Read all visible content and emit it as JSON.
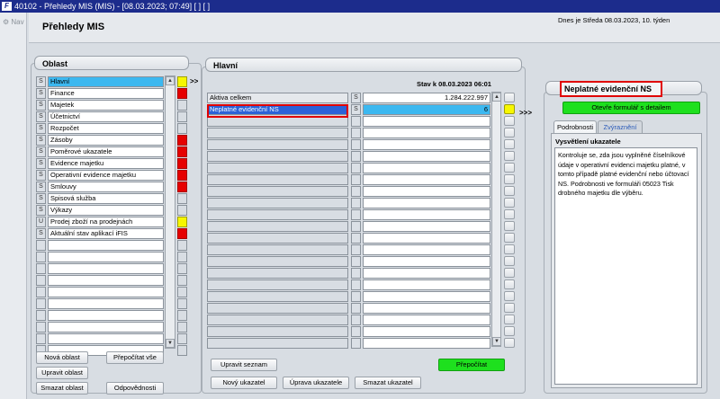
{
  "window": {
    "title": "40102 - Přehledy MIS (MIS) - [08.03.2023; 07:49] [ ] [ ]"
  },
  "nav": {
    "label": "Nav"
  },
  "header": {
    "title": "Přehledy MIS",
    "today": "Dnes je Středa   08.03.2023, 10. týden"
  },
  "oblast": {
    "title": "Oblast",
    "rows": [
      {
        "flag": "S",
        "label": "Hlavní",
        "status": "yellow",
        "selected": true
      },
      {
        "flag": "S",
        "label": "Finance",
        "status": "red"
      },
      {
        "flag": "S",
        "label": "Majetek",
        "status": "empty"
      },
      {
        "flag": "S",
        "label": "Účetnictví",
        "status": "empty"
      },
      {
        "flag": "S",
        "label": "Rozpočet",
        "status": "empty"
      },
      {
        "flag": "S",
        "label": "Zásoby",
        "status": "red"
      },
      {
        "flag": "S",
        "label": "Poměrové ukazatele",
        "status": "red"
      },
      {
        "flag": "S",
        "label": "Evidence majetku",
        "status": "red"
      },
      {
        "flag": "S",
        "label": "Operativní evidence majetku",
        "status": "red"
      },
      {
        "flag": "S",
        "label": "Smlouvy",
        "status": "red"
      },
      {
        "flag": "S",
        "label": "Spisová služba",
        "status": "empty"
      },
      {
        "flag": "S",
        "label": "Výkazy",
        "status": "empty"
      },
      {
        "flag": "U",
        "label": "Prodej zboží na prodejnách",
        "status": "yellow"
      },
      {
        "flag": "S",
        "label": "Aktuální stav aplikací iFIS",
        "status": "red"
      },
      {
        "flag": "",
        "label": "",
        "status": "empty"
      },
      {
        "flag": "",
        "label": "",
        "status": "empty"
      },
      {
        "flag": "",
        "label": "",
        "status": "empty"
      },
      {
        "flag": "",
        "label": "",
        "status": "empty"
      },
      {
        "flag": "",
        "label": "",
        "status": "empty"
      },
      {
        "flag": "",
        "label": "",
        "status": "empty"
      },
      {
        "flag": "",
        "label": "",
        "status": "empty"
      },
      {
        "flag": "",
        "label": "",
        "status": "empty"
      },
      {
        "flag": "",
        "label": "",
        "status": "empty"
      },
      {
        "flag": "",
        "label": "",
        "status": "empty"
      }
    ],
    "arrow": ">>",
    "buttons": {
      "new": "Nová oblast",
      "recalc_all": "Přepočítat vše",
      "edit": "Upravit oblast",
      "delete": "Smazat oblast",
      "responsibilities": "Odpovědnosti"
    }
  },
  "hlavni": {
    "title": "Hlavní",
    "state": "Stav k 08.03.2023 06:01",
    "rows": [
      {
        "name": "Aktiva celkem",
        "flag": "S",
        "value": "1.284.222.997",
        "indicator": ""
      },
      {
        "name": "Neplatné evidenční NS",
        "flag": "S",
        "value": "6",
        "indicator": "yellow",
        "selected": true
      },
      {
        "name": "",
        "flag": "",
        "value": "",
        "indicator": ""
      },
      {
        "name": "",
        "flag": "",
        "value": "",
        "indicator": ""
      },
      {
        "name": "",
        "flag": "",
        "value": "",
        "indicator": ""
      },
      {
        "name": "",
        "flag": "",
        "value": "",
        "indicator": ""
      },
      {
        "name": "",
        "flag": "",
        "value": "",
        "indicator": ""
      },
      {
        "name": "",
        "flag": "",
        "value": "",
        "indicator": ""
      },
      {
        "name": "",
        "flag": "",
        "value": "",
        "indicator": ""
      },
      {
        "name": "",
        "flag": "",
        "value": "",
        "indicator": ""
      },
      {
        "name": "",
        "flag": "",
        "value": "",
        "indicator": ""
      },
      {
        "name": "",
        "flag": "",
        "value": "",
        "indicator": ""
      },
      {
        "name": "",
        "flag": "",
        "value": "",
        "indicator": ""
      },
      {
        "name": "",
        "flag": "",
        "value": "",
        "indicator": ""
      },
      {
        "name": "",
        "flag": "",
        "value": "",
        "indicator": ""
      },
      {
        "name": "",
        "flag": "",
        "value": "",
        "indicator": ""
      },
      {
        "name": "",
        "flag": "",
        "value": "",
        "indicator": ""
      },
      {
        "name": "",
        "flag": "",
        "value": "",
        "indicator": ""
      },
      {
        "name": "",
        "flag": "",
        "value": "",
        "indicator": ""
      },
      {
        "name": "",
        "flag": "",
        "value": "",
        "indicator": ""
      },
      {
        "name": "",
        "flag": "",
        "value": "",
        "indicator": ""
      },
      {
        "name": "",
        "flag": "",
        "value": "",
        "indicator": ""
      }
    ],
    "arrow": ">>>",
    "buttons": {
      "edit_list": "Upravit seznam",
      "recalc": "Přepočítat",
      "new": "Nový ukazatel",
      "edit": "Úprava ukazatele",
      "delete": "Smazat ukazatel"
    }
  },
  "detail": {
    "title": "Neplatné evidenční NS",
    "open_button": "Otevře formulář s detailem",
    "tabs": [
      "Podrobnosti",
      "Zvýraznění"
    ],
    "section": "Vysvětlení ukazatele",
    "description": "Kontroluje se, zda jsou vyplněné číselníkové údaje v operativní evidenci majetku platné, v tomto případě platné evidenční nebo účtovací NS. Podrobnosti ve formuláři 05023 Tisk drobného majetku dle výběru."
  },
  "colors": {
    "title_bar": "#1c2c8c",
    "selected_row": "#3cb8f0",
    "status_red": "#e60000",
    "status_yellow": "#f7f700",
    "green_button": "#1ee01e",
    "highlight": "#e00000"
  }
}
